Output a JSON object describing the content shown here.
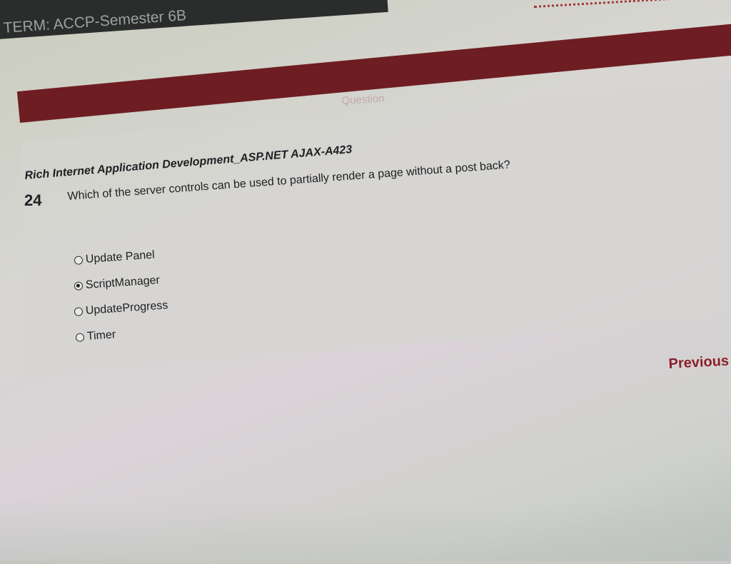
{
  "header": {
    "term_label": "TERM: ACCP-Semester 6B"
  },
  "question_section": {
    "heading": "Question",
    "subject": "Rich Internet Application Development_ASP.NET AJAX-A423",
    "number": "24",
    "text": "Which of the server controls can be used to partially render a page without a post back?",
    "options": [
      {
        "label": "Update Panel",
        "selected": false
      },
      {
        "label": "ScriptManager",
        "selected": true
      },
      {
        "label": "UpdateProgress",
        "selected": false
      },
      {
        "label": "Timer",
        "selected": false
      }
    ]
  },
  "navigation": {
    "previous_label": "Previous"
  },
  "colors": {
    "accent": "#6e1d22",
    "link": "#8c1e2a",
    "topbar": "#2a2d2c"
  }
}
